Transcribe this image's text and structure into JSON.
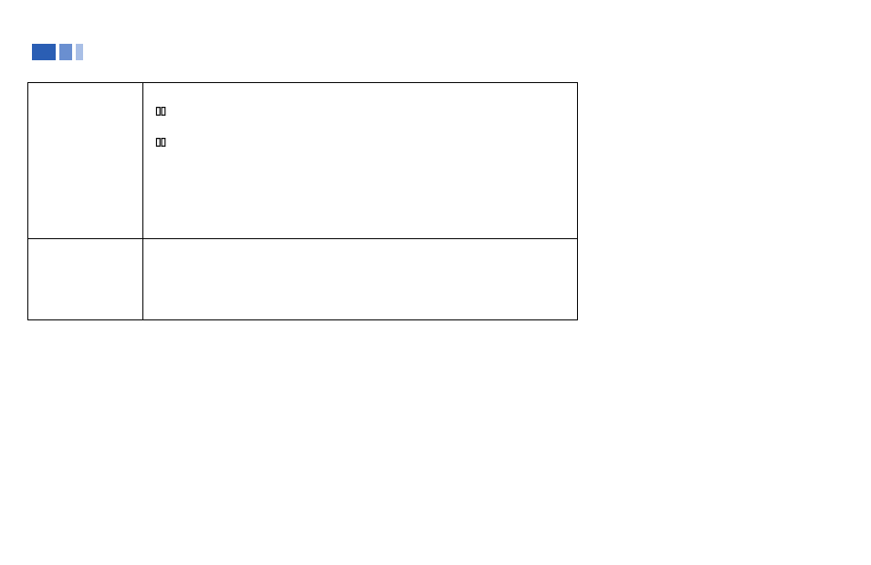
{
  "brand": {
    "bar_colors": [
      "#2a5eb4",
      "#6a8fd0",
      "#a9bfe6"
    ]
  },
  "icons": {
    "dolby": "▯▯"
  },
  "table": {
    "rows": [
      {
        "label": "",
        "content": ""
      },
      {
        "label": "",
        "content": ""
      }
    ]
  }
}
